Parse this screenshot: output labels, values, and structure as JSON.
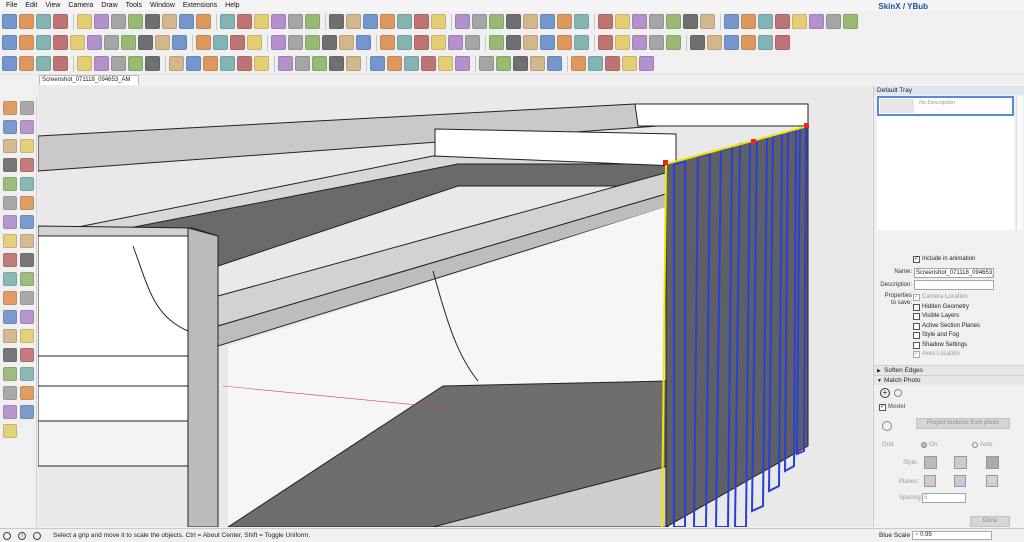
{
  "menu": [
    "File",
    "Edit",
    "View",
    "Camera",
    "Draw",
    "Tools",
    "Window",
    "Extensions",
    "Help"
  ],
  "toolbar": {
    "skin_label": "SkinX / YBub"
  },
  "scene_tab": "Screenshot_071118_094653_AM",
  "tray": {
    "title": "Default Tray",
    "thumb_text": "No Description",
    "include_in_animation": "Include in animation",
    "name_label": "Name:",
    "name_value": "Screenshot_071118_094653_",
    "description_label": "Description:",
    "description_value": "",
    "properties_label_1": "Properties",
    "properties_label_2": "to save:",
    "properties": [
      {
        "label": "Camera Location",
        "checked": true,
        "dim": true
      },
      {
        "label": "Hidden Geometry",
        "checked": false,
        "dim": false
      },
      {
        "label": "Visible Layers",
        "checked": false,
        "dim": false
      },
      {
        "label": "Active Section Planes",
        "checked": false,
        "dim": false
      },
      {
        "label": "Style and Fog",
        "checked": false,
        "dim": false
      },
      {
        "label": "Shadow Settings",
        "checked": false,
        "dim": false
      },
      {
        "label": "Axes Location",
        "checked": true,
        "dim": true
      }
    ],
    "soften_edges": "Soften Edges",
    "match_photo": "Match Photo",
    "model_label": "Model",
    "project_textures": "Project textures from photo",
    "grid_label": "Grid",
    "grid_on": "On",
    "grid_auto": "Auto",
    "style_label": "Style:",
    "planes_label": "Planes:",
    "spacing_label": "Spacing:",
    "spacing_value": "5'",
    "done_label": "Done"
  },
  "status": {
    "message": "Select a grip and move it to scale the objects. Ctrl = About Center, Shift = Toggle Uniform.",
    "vcb_label": "Blue Scale",
    "vcb_value": "~ 0.95"
  },
  "colors": {
    "accent": "#2a3fd8",
    "selection": "#f2e600",
    "tray_highlight": "#5b8bd6"
  }
}
